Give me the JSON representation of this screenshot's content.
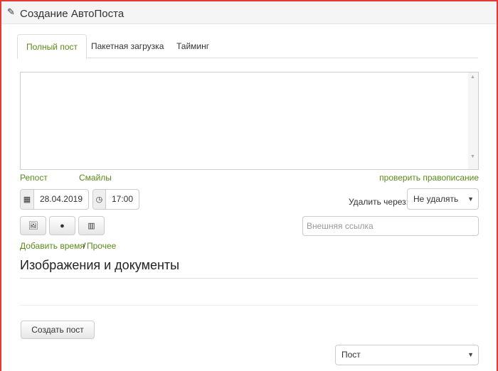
{
  "header": {
    "title": "Создание АвтоПоста",
    "icon": "pencil-icon"
  },
  "tabs": [
    {
      "label": "Полный пост"
    },
    {
      "label": "Пакетная загрузка"
    },
    {
      "label": "Тайминг"
    }
  ],
  "editor": {
    "text": ""
  },
  "links": {
    "repost": "Репост",
    "smiles": "Смайлы",
    "spellcheck": "проверить правописание",
    "add_time": "Добавить время",
    "separator": "/",
    "other": "Прочее"
  },
  "date": "28.04.2019",
  "time": "17:00",
  "delete": {
    "label": "Удалить через:",
    "value": "Не удалять"
  },
  "external_link": {
    "placeholder": "Внешняя ссылка"
  },
  "section_title": "Изображения и документы",
  "create_button": "Создать пост",
  "post_type": "Пост",
  "colors": {
    "accent": "#5a8a1a",
    "frame": "#e53935"
  }
}
